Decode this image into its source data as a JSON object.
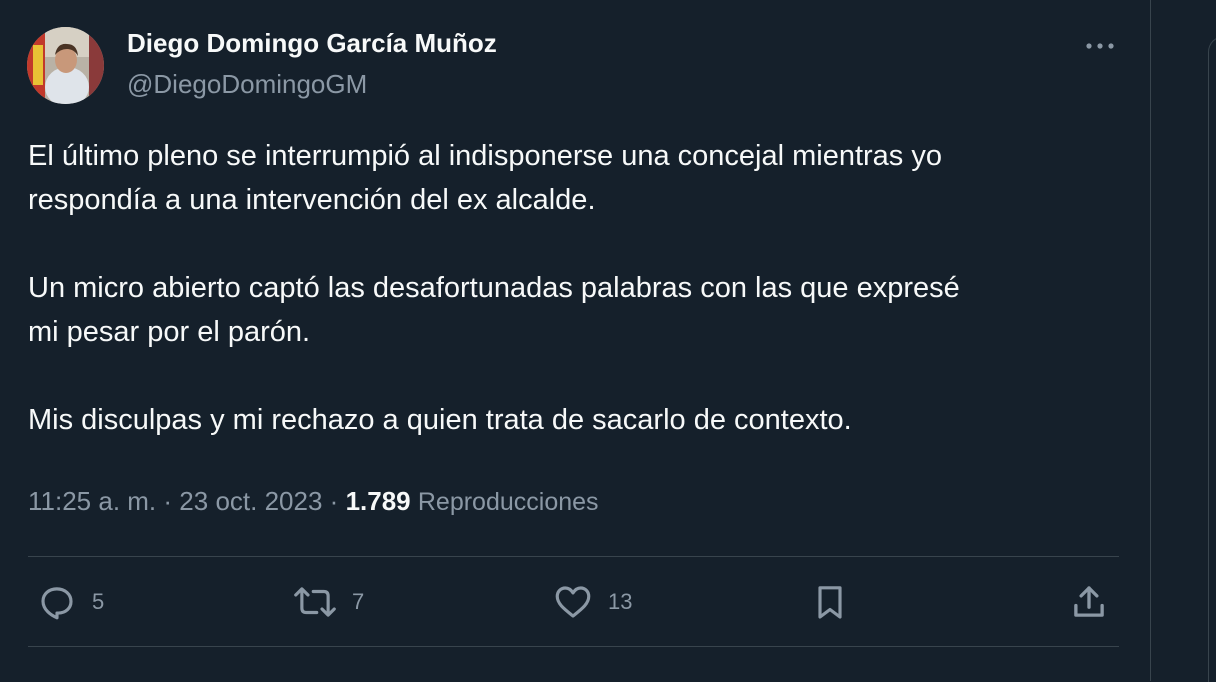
{
  "author": {
    "name": "Diego Domingo García Muñoz",
    "handle": "@DiegoDomingoGM"
  },
  "tweet": {
    "paragraphs": [
      [
        "El último pleno se interrumpió al indisponerse una concejal mientras yo",
        "respondía a una intervención del ex alcalde."
      ],
      [
        "Un micro abierto captó las desafortunadas palabras con las que expresé",
        "mi pesar por el parón."
      ],
      [
        "Mis disculpas y mi rechazo a quien trata de sacarlo de contexto."
      ]
    ]
  },
  "meta": {
    "time": "11:25 a. m.",
    "separator": "·",
    "date": "23 oct. 2023",
    "views_count": "1.789",
    "views_label": "Reproducciones"
  },
  "actions": {
    "replies": "5",
    "retweets": "7",
    "likes": "13"
  },
  "icons": {
    "more": "more-horizontal-icon",
    "reply": "reply-bubble-icon",
    "retweet": "retweet-icon",
    "like": "heart-icon",
    "bookmark": "bookmark-icon",
    "share": "share-upload-icon"
  },
  "colors": {
    "background": "#15202b",
    "primary_text": "#f7f9f9",
    "secondary_text": "#8b98a5",
    "divider": "#38444d"
  }
}
